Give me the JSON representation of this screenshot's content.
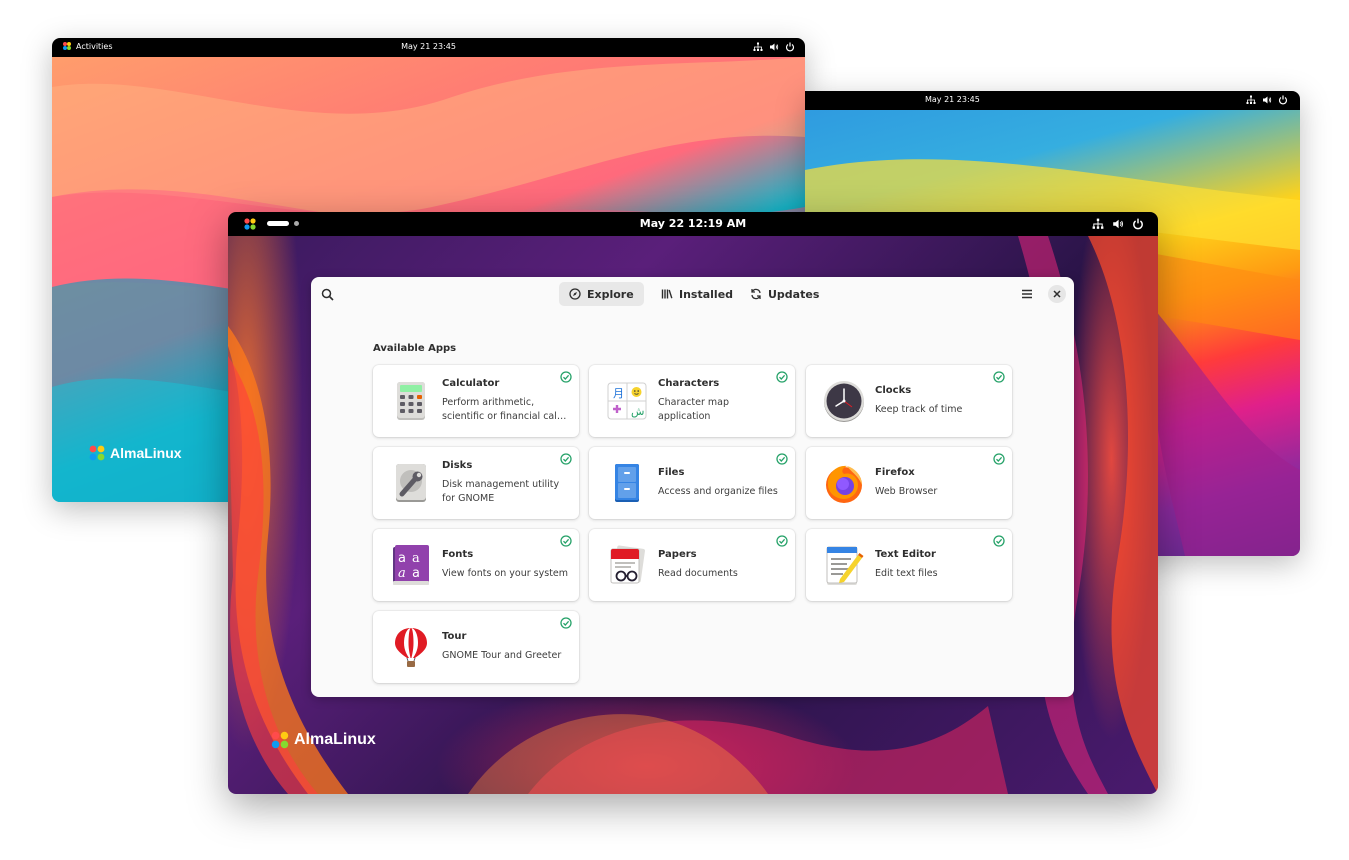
{
  "screens": {
    "left": {
      "activities_label": "Activities",
      "clock": "May 21  23:45",
      "logo_text": "AlmaLinux"
    },
    "right": {
      "clock": "May 21  23:45"
    },
    "front": {
      "clock": "May 22  12:19 AM",
      "logo_text": "AlmaLinux"
    }
  },
  "software": {
    "tabs": [
      {
        "label": "Explore",
        "icon": "compass-icon",
        "active": true
      },
      {
        "label": "Installed",
        "icon": "library-icon",
        "active": false
      },
      {
        "label": "Updates",
        "icon": "refresh-icon",
        "active": false
      }
    ],
    "section_title": "Available Apps",
    "apps": [
      {
        "name": "Calculator",
        "desc": "Perform arithmetic, scientific or financial cal…",
        "icon": "calculator-icon",
        "installed": true
      },
      {
        "name": "Characters",
        "desc": "Character map application",
        "icon": "characters-icon",
        "installed": true
      },
      {
        "name": "Clocks",
        "desc": "Keep track of time",
        "icon": "clocks-icon",
        "installed": true
      },
      {
        "name": "Disks",
        "desc": "Disk management utility for GNOME",
        "icon": "disks-icon",
        "installed": true
      },
      {
        "name": "Files",
        "desc": "Access and organize files",
        "icon": "files-icon",
        "installed": true
      },
      {
        "name": "Firefox",
        "desc": "Web Browser",
        "icon": "firefox-icon",
        "installed": true
      },
      {
        "name": "Fonts",
        "desc": "View fonts on your system",
        "icon": "fonts-icon",
        "installed": true
      },
      {
        "name": "Papers",
        "desc": "Read documents",
        "icon": "papers-icon",
        "installed": true
      },
      {
        "name": "Text Editor",
        "desc": "Edit text files",
        "icon": "text-editor-icon",
        "installed": true
      },
      {
        "name": "Tour",
        "desc": "GNOME Tour and Greeter",
        "icon": "tour-icon",
        "installed": true
      }
    ]
  },
  "colors": {
    "accent_check": "#26a269",
    "topbar": "#000000",
    "window_bg": "#fafafa"
  }
}
